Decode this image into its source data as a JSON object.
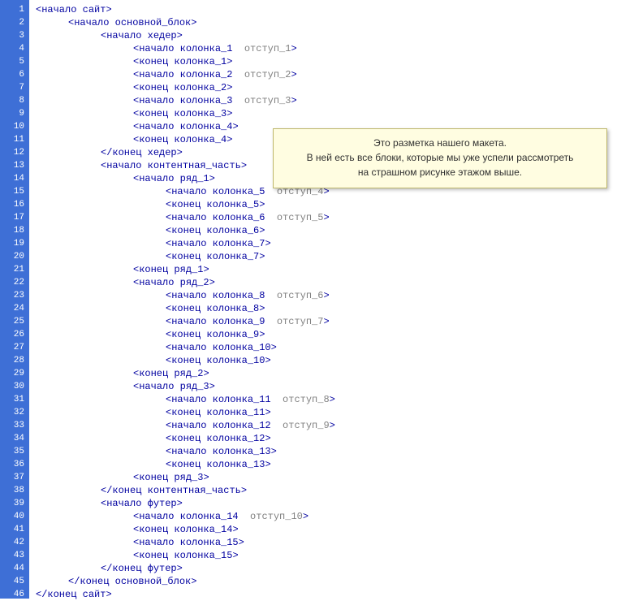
{
  "gutter": {
    "start": 1,
    "end": 46
  },
  "callout": {
    "line1": "Это разметка нашего макета.",
    "line2": "В ней есть все блоки, которые мы уже успели рассмотреть",
    "line3": "на страшном рисунке этажом выше."
  },
  "code": [
    {
      "indent": 0,
      "open": true,
      "close": false,
      "name": "сайт",
      "attr": null
    },
    {
      "indent": 1,
      "open": true,
      "close": false,
      "name": "основной_блок",
      "attr": null
    },
    {
      "indent": 2,
      "open": true,
      "close": false,
      "name": "хедер",
      "attr": null
    },
    {
      "indent": 3,
      "open": true,
      "close": false,
      "name": "колонка_1",
      "attr": "отступ_1"
    },
    {
      "indent": 3,
      "open": false,
      "close": false,
      "name": "колонка_1",
      "attr": null
    },
    {
      "indent": 3,
      "open": true,
      "close": false,
      "name": "колонка_2",
      "attr": "отступ_2"
    },
    {
      "indent": 3,
      "open": false,
      "close": false,
      "name": "колонка_2",
      "attr": null
    },
    {
      "indent": 3,
      "open": true,
      "close": false,
      "name": "колонка_3",
      "attr": "отступ_3"
    },
    {
      "indent": 3,
      "open": false,
      "close": false,
      "name": "колонка_3",
      "attr": null
    },
    {
      "indent": 3,
      "open": true,
      "close": false,
      "name": "колонка_4",
      "attr": null
    },
    {
      "indent": 3,
      "open": false,
      "close": false,
      "name": "колонка_4",
      "attr": null
    },
    {
      "indent": 2,
      "open": false,
      "close": true,
      "name": "хедер",
      "attr": null
    },
    {
      "indent": 2,
      "open": true,
      "close": false,
      "name": "контентная_часть",
      "attr": null
    },
    {
      "indent": 3,
      "open": true,
      "close": false,
      "name": "ряд_1",
      "attr": null
    },
    {
      "indent": 4,
      "open": true,
      "close": false,
      "name": "колонка_5",
      "attr": "отступ_4"
    },
    {
      "indent": 4,
      "open": false,
      "close": false,
      "name": "колонка_5",
      "attr": null
    },
    {
      "indent": 4,
      "open": true,
      "close": false,
      "name": "колонка_6",
      "attr": "отступ_5"
    },
    {
      "indent": 4,
      "open": false,
      "close": false,
      "name": "колонка_6",
      "attr": null
    },
    {
      "indent": 4,
      "open": true,
      "close": false,
      "name": "колонка_7",
      "attr": null
    },
    {
      "indent": 4,
      "open": false,
      "close": false,
      "name": "колонка_7",
      "attr": null
    },
    {
      "indent": 3,
      "open": false,
      "close": false,
      "name": "ряд_1",
      "attr": null
    },
    {
      "indent": 3,
      "open": true,
      "close": false,
      "name": "ряд_2",
      "attr": null
    },
    {
      "indent": 4,
      "open": true,
      "close": false,
      "name": "колонка_8",
      "attr": "отступ_6"
    },
    {
      "indent": 4,
      "open": false,
      "close": false,
      "name": "колонка_8",
      "attr": null
    },
    {
      "indent": 4,
      "open": true,
      "close": false,
      "name": "колонка_9",
      "attr": "отступ_7"
    },
    {
      "indent": 4,
      "open": false,
      "close": false,
      "name": "колонка_9",
      "attr": null
    },
    {
      "indent": 4,
      "open": true,
      "close": false,
      "name": "колонка_10",
      "attr": null
    },
    {
      "indent": 4,
      "open": false,
      "close": false,
      "name": "колонка_10",
      "attr": null
    },
    {
      "indent": 3,
      "open": false,
      "close": false,
      "name": "ряд_2",
      "attr": null
    },
    {
      "indent": 3,
      "open": true,
      "close": false,
      "name": "ряд_3",
      "attr": null
    },
    {
      "indent": 4,
      "open": true,
      "close": false,
      "name": "колонка_11",
      "attr": "отступ_8"
    },
    {
      "indent": 4,
      "open": false,
      "close": false,
      "name": "колонка_11",
      "attr": null
    },
    {
      "indent": 4,
      "open": true,
      "close": false,
      "name": "колонка_12",
      "attr": "отступ_9"
    },
    {
      "indent": 4,
      "open": false,
      "close": false,
      "name": "колонка_12",
      "attr": null
    },
    {
      "indent": 4,
      "open": true,
      "close": false,
      "name": "колонка_13",
      "attr": null
    },
    {
      "indent": 4,
      "open": false,
      "close": false,
      "name": "колонка_13",
      "attr": null
    },
    {
      "indent": 3,
      "open": false,
      "close": false,
      "name": "ряд_3",
      "attr": null
    },
    {
      "indent": 2,
      "open": false,
      "close": true,
      "name": "контентная_часть",
      "attr": null
    },
    {
      "indent": 2,
      "open": true,
      "close": false,
      "name": "футер",
      "attr": null
    },
    {
      "indent": 3,
      "open": true,
      "close": false,
      "name": "колонка_14",
      "attr": "отступ_10"
    },
    {
      "indent": 3,
      "open": false,
      "close": false,
      "name": "колонка_14",
      "attr": null
    },
    {
      "indent": 3,
      "open": true,
      "close": false,
      "name": "колонка_15",
      "attr": null
    },
    {
      "indent": 3,
      "open": false,
      "close": false,
      "name": "колонка_15",
      "attr": null
    },
    {
      "indent": 2,
      "open": false,
      "close": true,
      "name": "футер",
      "attr": null
    },
    {
      "indent": 1,
      "open": false,
      "close": true,
      "name": "основной_блок",
      "attr": null
    },
    {
      "indent": 0,
      "open": false,
      "close": true,
      "name": "сайт",
      "attr": null
    }
  ]
}
